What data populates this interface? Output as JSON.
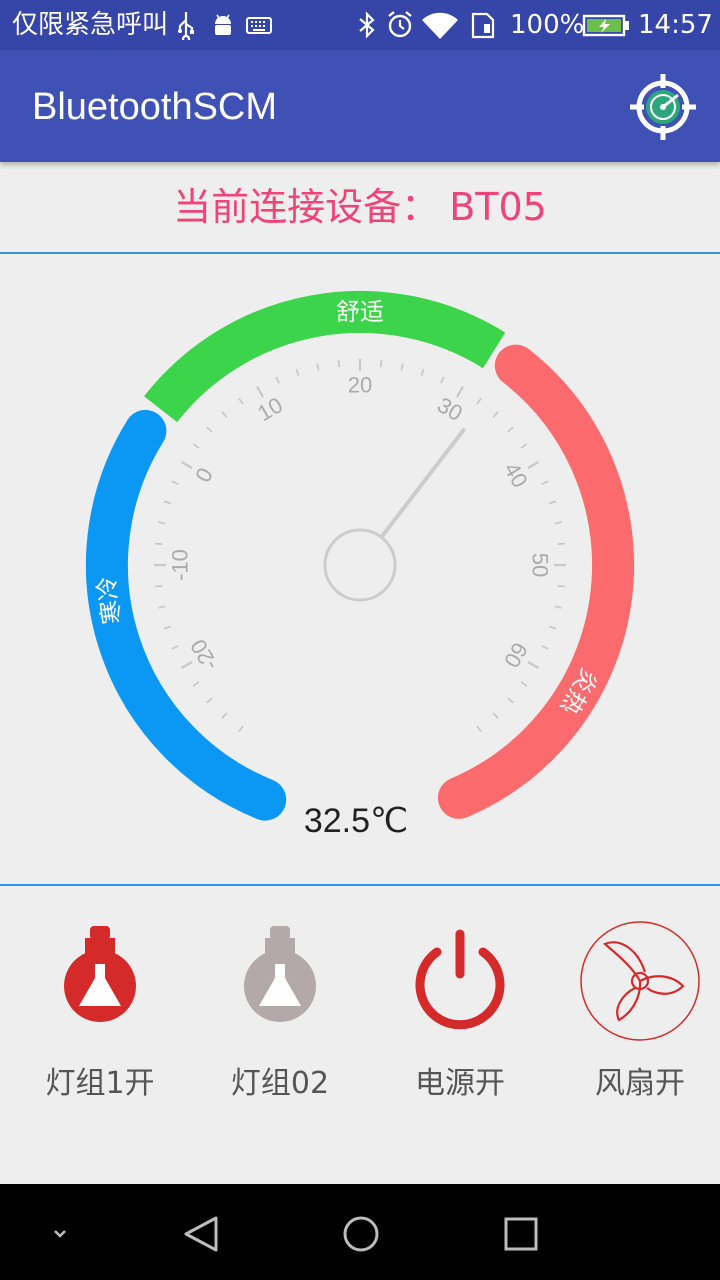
{
  "status_bar": {
    "carrier": "仅限紧急呼叫",
    "battery_percent": "100%",
    "time": "14:57",
    "icons": [
      "usb-icon",
      "android-debug-icon",
      "keyboard-icon",
      "bluetooth-icon",
      "alarm-icon",
      "wifi-icon",
      "sim-icon",
      "battery-icon"
    ]
  },
  "app_bar": {
    "title": "BluetoothSCM",
    "action_icon": "connect-target-icon"
  },
  "device": {
    "label": "当前连接设备：",
    "name": "BT05",
    "color": "#ee4477"
  },
  "gauge": {
    "temperature_value": 32.5,
    "temperature_text": "32.5℃",
    "scale_min": -30,
    "scale_max": 70,
    "tick_labels": [
      "-20",
      "-10",
      "0",
      "10",
      "20",
      "30",
      "40",
      "50",
      "60"
    ],
    "zones": [
      {
        "label": "寒冷",
        "color": "#0b98f5"
      },
      {
        "label": "舒适",
        "color": "#3bd44b"
      },
      {
        "label": "炎热",
        "color": "#fb6b6e"
      }
    ]
  },
  "controls": [
    {
      "label": "灯组1开",
      "icon": "bulb-on-icon",
      "active": true
    },
    {
      "label": "灯组02",
      "icon": "bulb-off-icon",
      "active": false
    },
    {
      "label": "电源开",
      "icon": "power-icon",
      "active": true
    },
    {
      "label": "风扇开",
      "icon": "fan-icon",
      "active": true
    }
  ],
  "colors": {
    "primary": "#3f51b5",
    "primary_dark": "#3545a8",
    "accent_red": "#d42a2a",
    "divider": "#2196f3"
  },
  "nav_bar": {
    "buttons": [
      "hide-keyboard-icon",
      "back-icon",
      "home-icon",
      "recents-icon"
    ]
  }
}
